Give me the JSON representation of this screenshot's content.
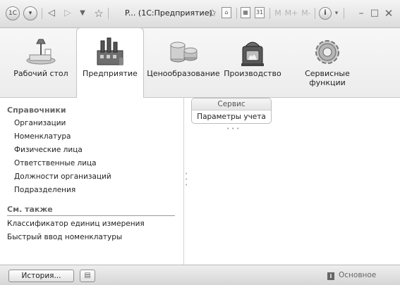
{
  "titlebar": {
    "title": "P... (1С:Предприятие)",
    "logo_text": "1С",
    "icons": [
      "app-logo-icon",
      "dropdown-circle-icon",
      "back-arrow-icon",
      "forward-arrow-icon",
      "dropdown-arrow-icon",
      "favorite-star-icon",
      "star-add-icon",
      "home-icon",
      "calculator-icon",
      "calendar-icon",
      "memory-m-icon",
      "memory-mplus-icon",
      "memory-mminus-icon",
      "info-icon",
      "minimize-icon",
      "maximize-icon",
      "close-icon"
    ],
    "memory_labels": [
      "M",
      "M+",
      "M-"
    ]
  },
  "sections": [
    {
      "label": "Рабочий стол",
      "icon": "desk-lamp-icon",
      "active": false
    },
    {
      "label": "Предприятие",
      "icon": "factory-icon",
      "active": true
    },
    {
      "label": "Ценообразование",
      "icon": "coins-icon",
      "active": false
    },
    {
      "label": "Производство",
      "icon": "furnace-icon",
      "active": false
    },
    {
      "label": "Сервисные функции",
      "icon": "gear-icon",
      "active": false
    }
  ],
  "catalogs": {
    "title": "Справочники",
    "items": [
      "Организации",
      "Номенклатура",
      "Физические лица",
      "Ответственные лица",
      "Должности организаций",
      "Подразделения"
    ]
  },
  "see_also": {
    "title": "См. также",
    "items": [
      "Классификатор единиц измерения",
      "Быстрый ввод номенклатуры"
    ]
  },
  "service": {
    "title": "Сервис",
    "items": [
      "Параметры учета"
    ]
  },
  "statusbar": {
    "history_label": "История...",
    "status_text": "Основное"
  }
}
